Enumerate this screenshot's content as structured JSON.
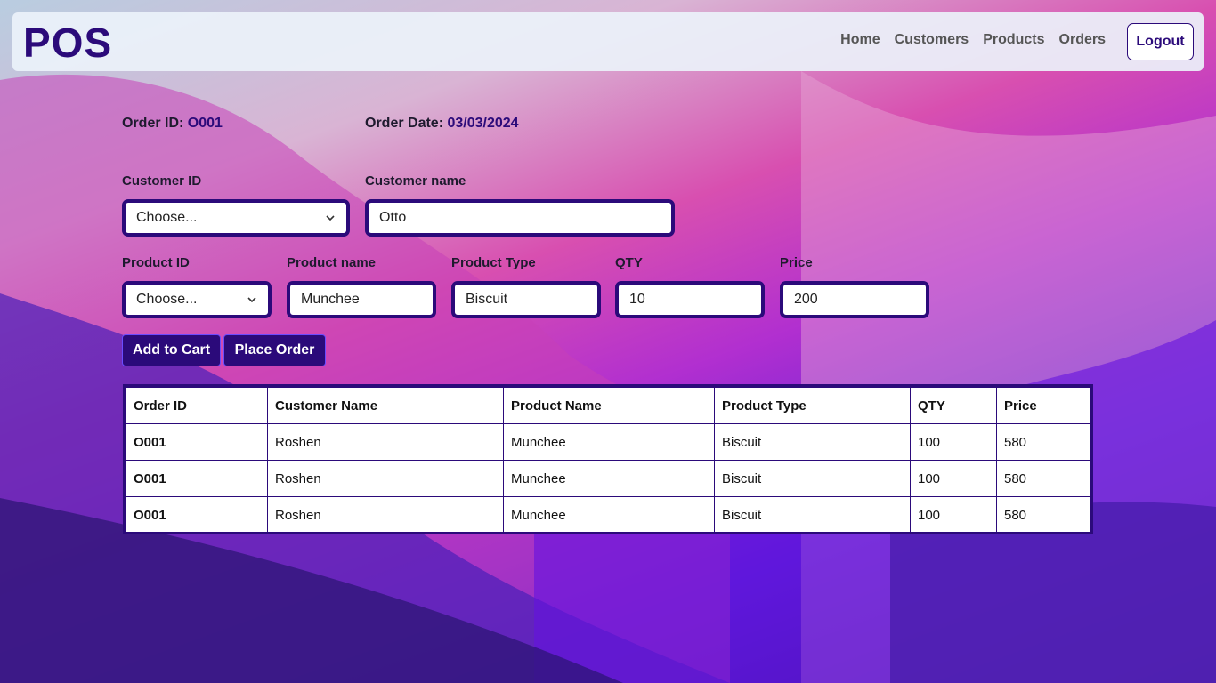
{
  "logo_text": "POS",
  "nav": {
    "links": [
      "Home",
      "Customers",
      "Products",
      "Orders"
    ],
    "logout_label": "Logout"
  },
  "order": {
    "id_label": "Order ID:",
    "id_value": "O001",
    "date_label": "Order Date:",
    "date_value": "03/03/2024"
  },
  "form": {
    "customer_id": {
      "label": "Customer ID",
      "value": "Choose..."
    },
    "customer_name": {
      "label": "Customer name",
      "value": "Otto"
    },
    "product_id": {
      "label": "Product ID",
      "value": "Choose..."
    },
    "product_name": {
      "label": "Product name",
      "value": "Munchee"
    },
    "product_type": {
      "label": "Product Type",
      "value": "Biscuit"
    },
    "qty": {
      "label": "QTY",
      "value": "10"
    },
    "price": {
      "label": "Price",
      "value": "200"
    }
  },
  "buttons": {
    "add_to_cart": "Add to Cart",
    "place_order": "Place Order"
  },
  "table": {
    "headers": [
      "Order ID",
      "Customer Name",
      "Product Name",
      "Product Type",
      "QTY",
      "Price"
    ],
    "rows": [
      [
        "O001",
        "Roshen",
        "Munchee",
        "Biscuit",
        "100",
        "580"
      ],
      [
        "O001",
        "Roshen",
        "Munchee",
        "Biscuit",
        "100",
        "580"
      ],
      [
        "O001",
        "Roshen",
        "Munchee",
        "Biscuit",
        "100",
        "580"
      ]
    ]
  },
  "colors": {
    "brand": "#2b0a7a",
    "accent_text": "#2b0a7a"
  },
  "icons": {
    "dropdown": "chevron-down-icon"
  }
}
